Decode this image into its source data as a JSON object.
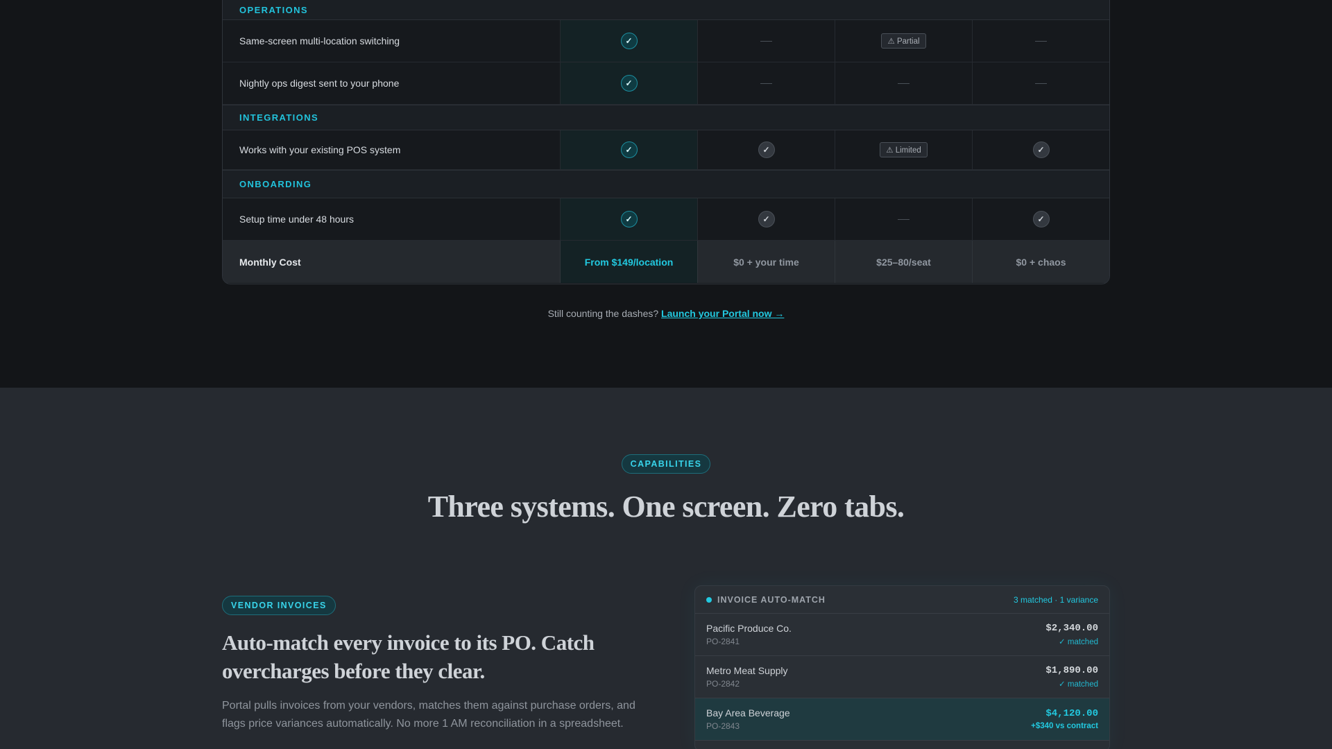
{
  "comparison": {
    "sections": {
      "operations": "OPERATIONS",
      "integrations": "INTEGRATIONS",
      "onboarding": "ONBOARDING"
    },
    "rows": {
      "multi_location": {
        "label": "Same-screen multi-location switching",
        "c3_tag": "⚠ Partial"
      },
      "nightly_digest": {
        "label": "Nightly ops digest sent to your phone"
      },
      "pos": {
        "label": "Works with your existing POS system",
        "c3_tag": "⚠ Limited"
      },
      "setup": {
        "label": "Setup time under 48 hours"
      }
    },
    "check_glyph": "✓",
    "cost": {
      "label": "Monthly Cost",
      "portal": "From $149/location",
      "col2": "$0 + your time",
      "col3": "$25–80/seat",
      "col4": "$0 + chaos"
    },
    "cta_text": "Still counting the dashes?",
    "cta_link": "Launch your Portal now →"
  },
  "capabilities": {
    "badge": "CAPABILITIES",
    "heading": "Three systems. One screen. Zero tabs.",
    "feature": {
      "badge": "VENDOR INVOICES",
      "heading": "Auto-match every invoice to its PO. Catch overcharges before they clear.",
      "body": "Portal pulls invoices from your vendors, matches them against purchase orders, and flags price variances automatically. No more 1 AM reconciliation in a spreadsheet."
    },
    "panel": {
      "title": "INVOICE AUTO-MATCH",
      "summary": "3 matched · 1 variance",
      "invoices": [
        {
          "vendor": "Pacific Produce Co.",
          "po": "PO-2841",
          "amount": "$2,340.00",
          "status": "✓ matched"
        },
        {
          "vendor": "Metro Meat Supply",
          "po": "PO-2842",
          "amount": "$1,890.00",
          "status": "✓ matched"
        },
        {
          "vendor": "Bay Area Beverage",
          "po": "PO-2843",
          "amount": "$4,120.00",
          "status": "+$340 vs contract"
        }
      ]
    }
  },
  "colors": {
    "accent": "#22c9e0",
    "bg_dark": "#131518",
    "bg_section": "#262a30"
  }
}
